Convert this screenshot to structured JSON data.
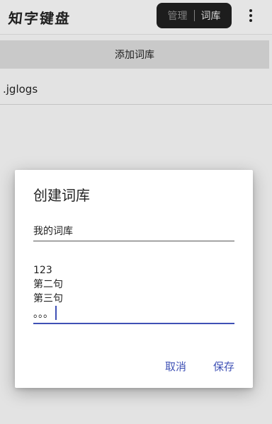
{
  "header": {
    "app_title": "知字键盘",
    "mode_manage": "管理",
    "mode_wordbank": "词库",
    "menu_icon": "more-vertical-icon"
  },
  "add_bar": {
    "label": "添加词库"
  },
  "list": {
    "items": [
      ".jglogs"
    ]
  },
  "dialog": {
    "title": "创建词库",
    "name_value": "我的词库",
    "content_lines": [
      "123",
      "第二句",
      "第三句",
      "。。。"
    ],
    "cancel_label": "取消",
    "save_label": "保存"
  },
  "colors": {
    "accent": "#3f51b5",
    "toggle_bg": "#1f1f1f",
    "add_bar_bg": "#d6d6d6"
  }
}
